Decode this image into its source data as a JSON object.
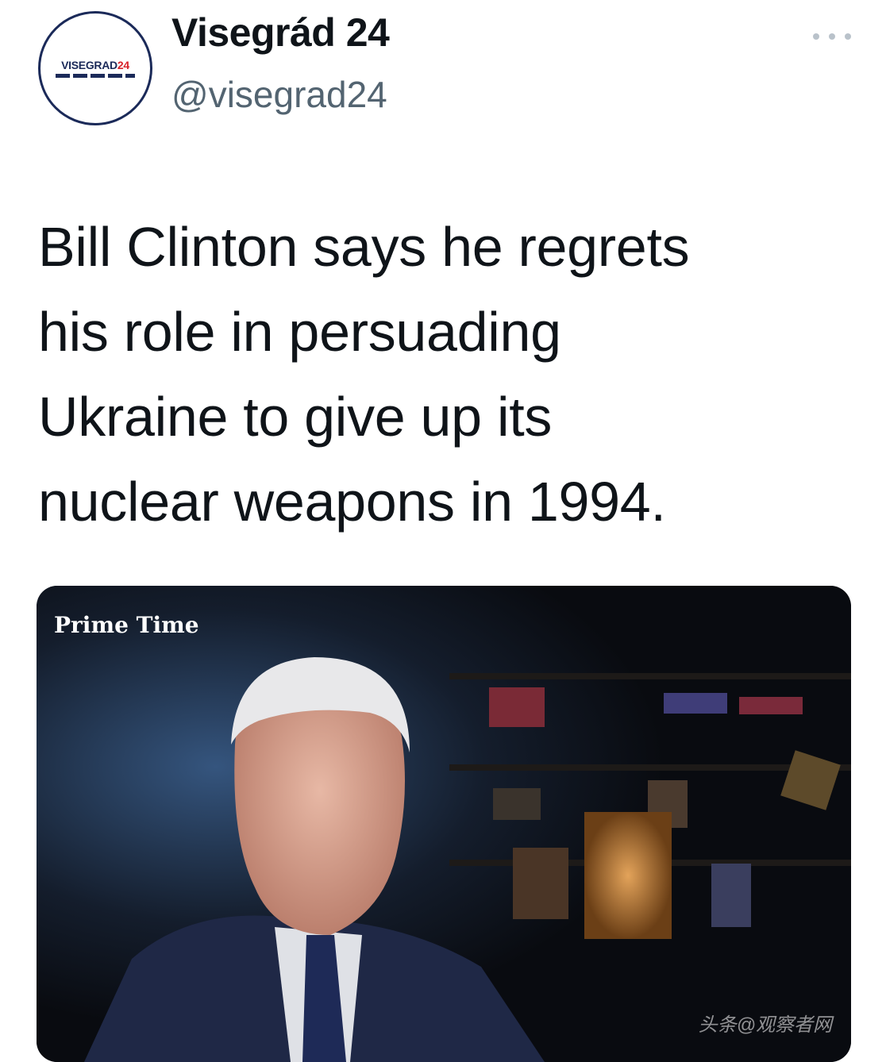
{
  "author": {
    "avatar_logo_text": "VISEGRAD",
    "avatar_logo_number": "24",
    "display_name": "Visegrád 24",
    "handle": "@visegrad24"
  },
  "menu": {
    "icon": "more-horizontal-icon"
  },
  "tweet": {
    "text_lines": [
      "Bill Clinton says he regrets",
      "his role in persuading",
      "Ukraine to give up its",
      "nuclear weapons in 1994."
    ]
  },
  "media": {
    "overlay_label": "Prime Time",
    "watermark": "头条@观察者网"
  },
  "colors": {
    "logo_navy": "#1b2a59",
    "logo_red": "#d8232a",
    "handle_gray": "#536471",
    "text": "#0f1419"
  }
}
